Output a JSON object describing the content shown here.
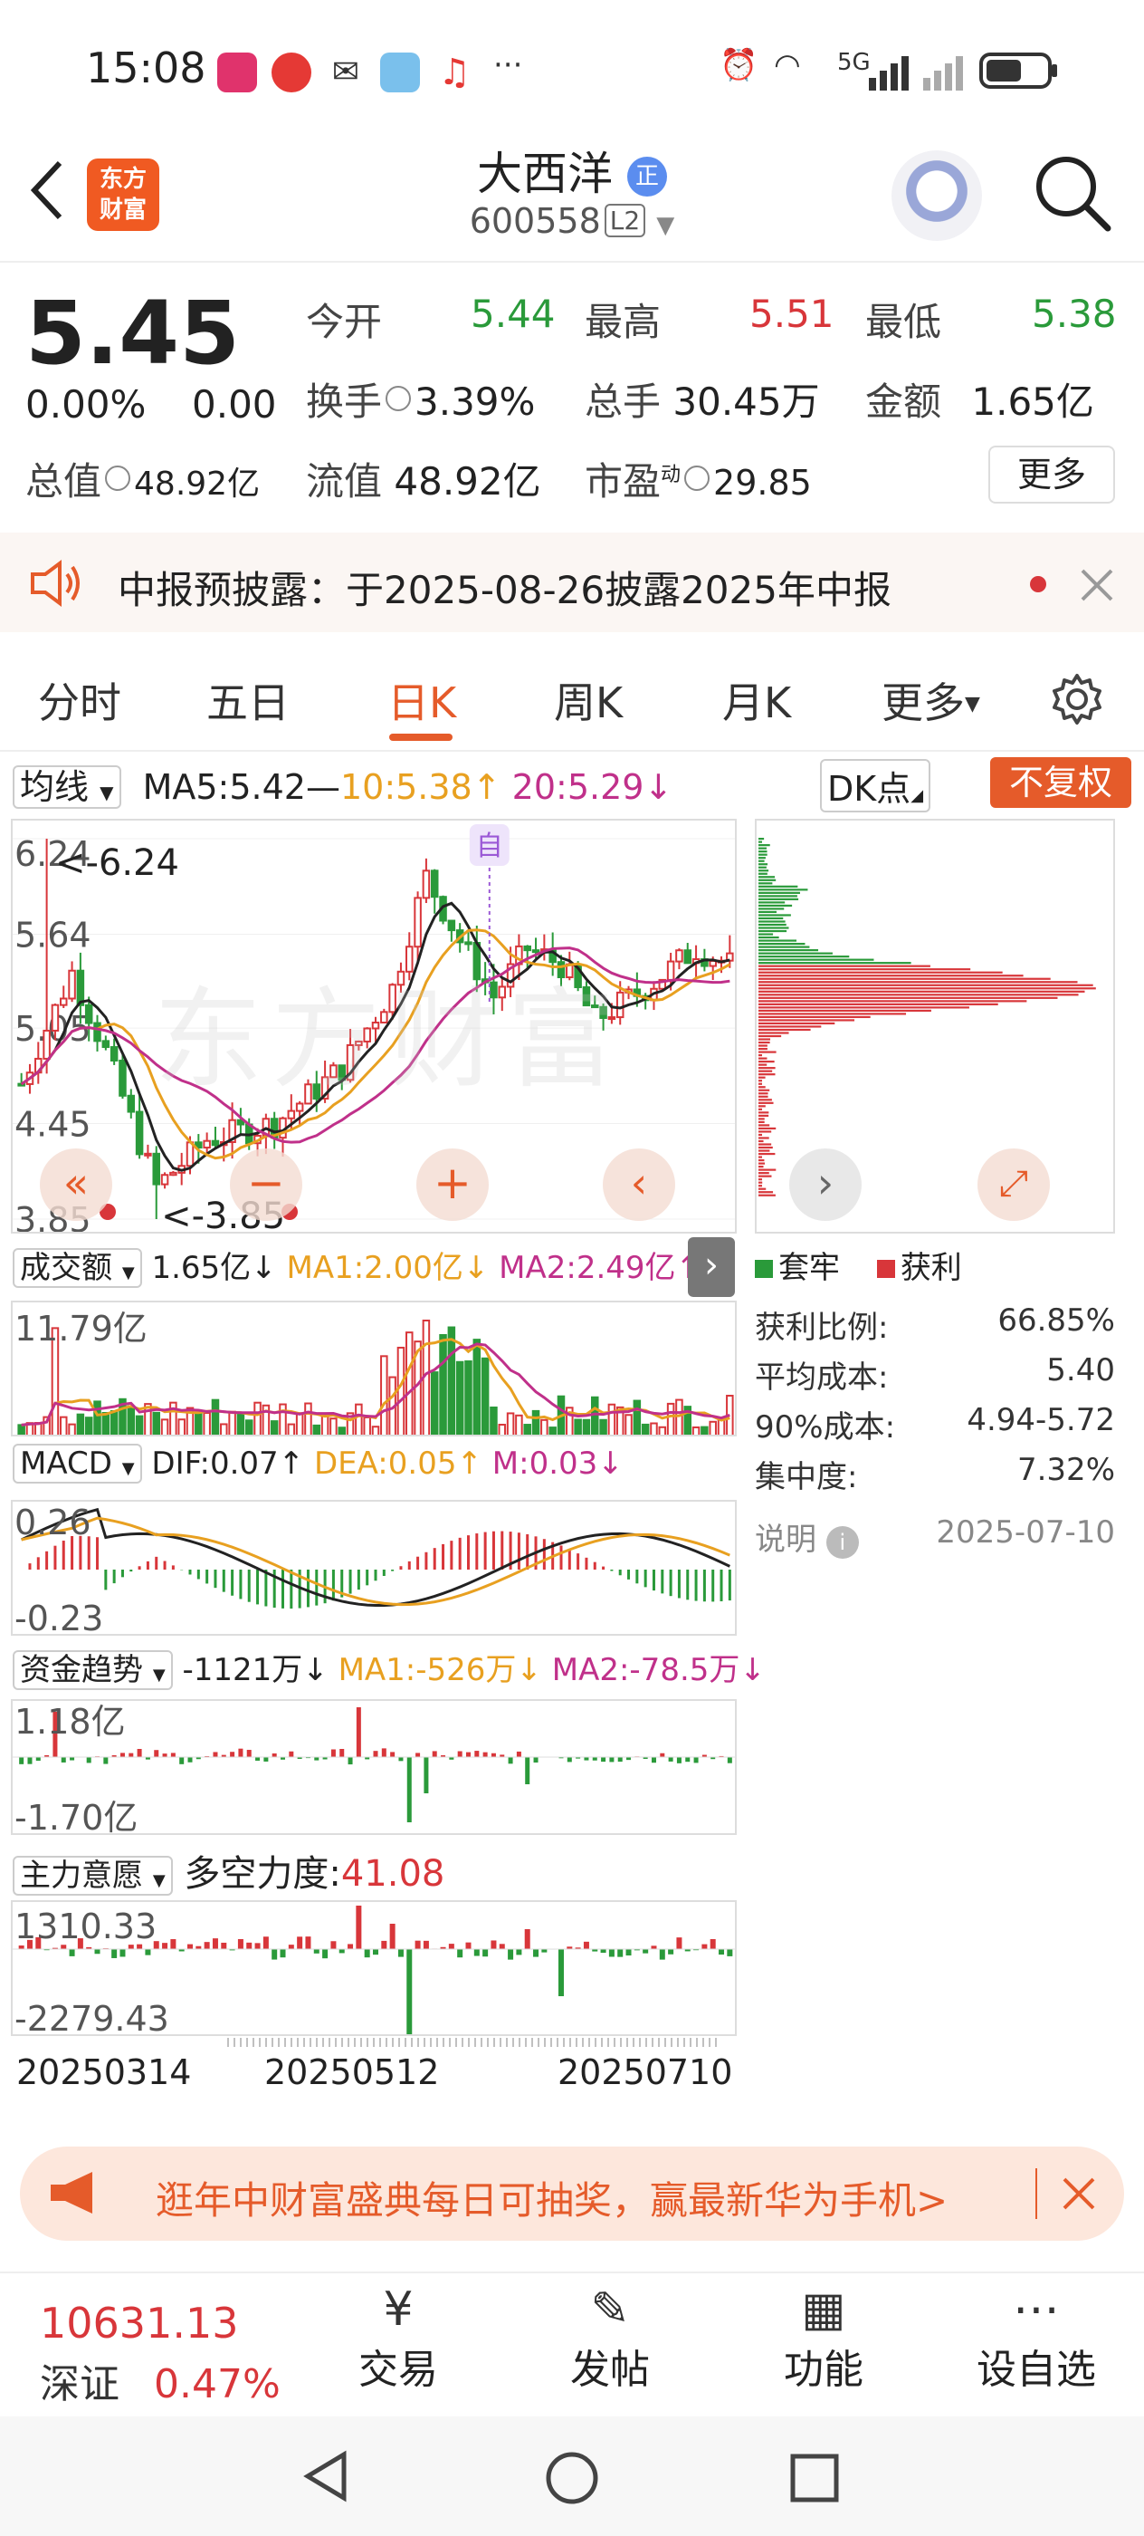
{
  "status_bar": {
    "time": "15:08",
    "dots": "···",
    "network": "5G"
  },
  "header": {
    "logo_text_line1": "东方",
    "logo_text_line2": "财富",
    "stock_name": "大西洋",
    "stock_tag": "正",
    "stock_code": "600558",
    "level": "L2"
  },
  "quote": {
    "price": "5.45",
    "change_pct": "0.00%",
    "change": "0.00",
    "open_label": "今开",
    "open": "5.44",
    "high_label": "最高",
    "high": "5.51",
    "low_label": "最低",
    "low": "5.38",
    "turnover_label": "换手",
    "turnover": "3.39%",
    "volume_label": "总手",
    "volume": "30.45万",
    "amount_label": "金额",
    "amount": "1.65亿",
    "mktcap_label": "总值",
    "mktcap": "48.92亿",
    "float_label": "流值",
    "float": "48.92亿",
    "pe_label": "市盈",
    "pe_sup": "动",
    "pe": "29.85",
    "more_label": "更多"
  },
  "notice": {
    "text": "中报预披露：于2025-08-26披露2025年中报"
  },
  "tabs": [
    "分时",
    "五日",
    "日K",
    "周K",
    "月K",
    "更多"
  ],
  "kline": {
    "ma_select": "均线",
    "ma5": "MA5:5.42—",
    "ma10": "10:5.38↑",
    "ma20": "20:5.29↓",
    "dk_label": "DK点",
    "fq_label": "不复权",
    "y_labels": [
      "6.24",
      "5.64",
      "5.05",
      "4.45",
      "3.85"
    ],
    "max_marker": "<-6.24",
    "min_marker": "<-3.85",
    "self_marker": "自",
    "watermark": "东方财富"
  },
  "volume": {
    "select": "成交额",
    "value": "1.65亿↓",
    "ma1": "MA1:2.00亿↓",
    "ma2": "MA2:2.49亿↑",
    "top_label": "11.79亿"
  },
  "macd": {
    "select": "MACD",
    "dif": "DIF:0.07↑",
    "dea": "DEA:0.05↑",
    "m": "M:0.03↓",
    "top_label": "0.26",
    "bottom_label": "-0.23"
  },
  "fund": {
    "select": "资金趋势",
    "value": "-1121万↓",
    "ma1": "MA1:-526万↓",
    "ma2": "MA2:-78.5万↓",
    "top_label": "1.18亿",
    "bottom_label": "-1.70亿"
  },
  "main_will": {
    "select": "主力意愿",
    "label": "多空力度:",
    "value": "41.08",
    "top_label": "1310.33",
    "bottom_label": "-2279.43"
  },
  "dates": [
    "20250314",
    "20250512",
    "20250710"
  ],
  "chip": {
    "legend_trapped": "套牢",
    "legend_profit": "获利",
    "rows": [
      {
        "label": "获利比例:",
        "value": "66.85%"
      },
      {
        "label": "平均成本:",
        "value": "5.40"
      },
      {
        "label": "90%成本:",
        "value": "4.94-5.72"
      },
      {
        "label": "集中度:",
        "value": "7.32%"
      }
    ],
    "note_label": "说明",
    "date": "2025-07-10"
  },
  "promo": {
    "text": "逛年中财富盛典每日可抽奖，赢最新华为手机>"
  },
  "bottom_nav": {
    "index_value": "10631.13",
    "index_name": "深证",
    "index_change": "0.47%",
    "items": [
      "交易",
      "发帖",
      "功能",
      "设自选"
    ]
  },
  "colors": {
    "up": "#d8363a",
    "down": "#2a9a3a",
    "accent": "#e55b2a",
    "ma5": "#222222",
    "ma10": "#e8a020",
    "ma20": "#c0308a"
  }
}
